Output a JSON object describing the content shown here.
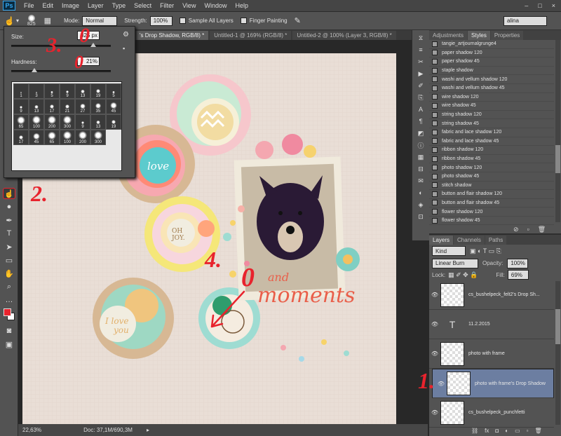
{
  "app": {
    "logo": "Ps"
  },
  "menu": [
    "File",
    "Edit",
    "Image",
    "Layer",
    "Type",
    "Select",
    "Filter",
    "View",
    "Window",
    "Help"
  ],
  "window_controls": [
    "–",
    "□",
    "×"
  ],
  "options_bar": {
    "brush_size": "825",
    "mode_label": "Mode:",
    "mode_value": "Normal",
    "strength_label": "Strength:",
    "strength_value": "100%",
    "sample_all_layers": "Sample All Layers",
    "finger_painting": "Finger Painting",
    "workspace": "alina"
  },
  "doc_tabs": [
    {
      "label": "'s Drop Shadow, RGB/8) *",
      "active": true
    },
    {
      "label": "Untitled-1 @ 169% (RGB/8) *",
      "active": false
    },
    {
      "label": "Untitled-2 @ 100% (Layer 3, RGB/8) *",
      "active": false
    }
  ],
  "brush_panel": {
    "size_label": "Size:",
    "size_value": "825 px",
    "hardness_label": "Hardness:",
    "hardness_value": "21%",
    "size_level": 0.82,
    "hardness_level": 0.21,
    "brushes": [
      "1",
      "3",
      "5",
      "9",
      "13",
      "19",
      "5",
      "9",
      "13",
      "17",
      "21",
      "27",
      "35",
      "45",
      "65",
      "100",
      "200",
      "300",
      "9",
      "13",
      "19",
      "17",
      "45",
      "65",
      "100",
      "200",
      "300"
    ]
  },
  "styles_panel": {
    "tabs": [
      "Adjustments",
      "Styles",
      "Properties"
    ],
    "active_tab": "Styles",
    "items": [
      "tangie_artjournalgrunge4",
      "paper shadow 120",
      "paper shadow 45",
      "staple shadow",
      "washi and vellum shadow 120",
      "washi and vellum shadow 45",
      "wire shadow 120",
      "wire shadow 45",
      "string shadow 120",
      "string shadow 45",
      "fabric and lace shadow 120",
      "fabric and lace shadow 45",
      "ribbon shadow 120",
      "ribbon shadow 45",
      "photo shadow 120",
      "photo shadow 45",
      "stitch shadow",
      "button and flair shadow 120",
      "button and flair shadow 45",
      "flower shadow 120",
      "flower shadow 45"
    ]
  },
  "layers_panel": {
    "tabs": [
      "Layers",
      "Channels",
      "Paths"
    ],
    "active_tab": "Layers",
    "kind_label": "Kind",
    "blend_mode": "Linear Burn",
    "opacity_label": "Opacity:",
    "opacity_value": "100%",
    "lock_label": "Lock:",
    "fill_label": "Fill:",
    "fill_value": "69%",
    "layers": [
      {
        "name": "cs_bushelpeck_felt2's Drop Sh...",
        "thumb": "transparent",
        "selected": false
      },
      {
        "name": "11.2.2015",
        "thumb": "text",
        "selected": false
      },
      {
        "name": "photo with frame",
        "thumb": "transparent",
        "selected": false
      },
      {
        "name": "photo with frame's Drop Shadow",
        "thumb": "transparent",
        "selected": true
      },
      {
        "name": "cs_bushelpeck_punchfetti",
        "thumb": "transparent",
        "selected": false
      }
    ]
  },
  "status": {
    "zoom": "22,63%",
    "doc": "Doc: 37,1M/690,3M"
  },
  "canvas_text": {
    "title_script": "and",
    "title": "moments"
  },
  "annotations": [
    "1.",
    "2.",
    "3.",
    "4.",
    "0",
    "0",
    "0"
  ],
  "colors": {
    "annotation": "#e8232d",
    "paper": "#e9ded6",
    "selected_layer": "#6c7ea1",
    "foreground": "#e8232d"
  }
}
